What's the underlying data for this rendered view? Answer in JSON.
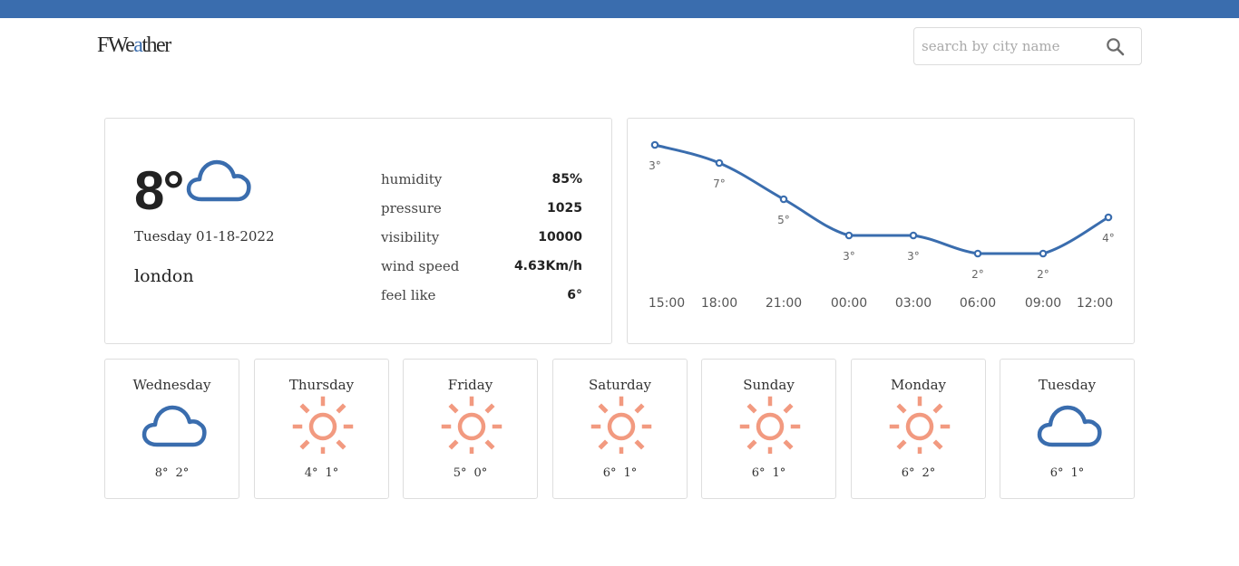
{
  "app": {
    "logo_main": "FWe",
    "logo_accent": "a",
    "logo_end": "ther"
  },
  "search": {
    "placeholder": "search by city name",
    "icon": "search-icon"
  },
  "current": {
    "temperature": "8°",
    "icon": "cloud-icon",
    "date": "Tuesday 01-18-2022",
    "city": "london",
    "stats": [
      {
        "label": "humidity",
        "value": "85%"
      },
      {
        "label": "pressure",
        "value": "1025"
      },
      {
        "label": "visibility",
        "value": "10000"
      },
      {
        "label": "wind speed",
        "value": "4.63Km/h"
      },
      {
        "label": "feel like",
        "value": "6°"
      }
    ]
  },
  "chart_data": {
    "type": "line",
    "categories": [
      "15:00",
      "18:00",
      "21:00",
      "00:00",
      "03:00",
      "06:00",
      "09:00",
      "12:00"
    ],
    "values": [
      8,
      7,
      5,
      3,
      3,
      2,
      2,
      4
    ],
    "point_labels": [
      "3°",
      "7°",
      "5°",
      "3°",
      "3°",
      "2°",
      "2°",
      "4°"
    ],
    "ylim": [
      2,
      8
    ],
    "color": "#3a6dae"
  },
  "forecast": [
    {
      "day": "Wednesday",
      "icon": "cloud-icon",
      "high": "8°",
      "low": "2°"
    },
    {
      "day": "Thursday",
      "icon": "sun-icon",
      "high": "4°",
      "low": "1°"
    },
    {
      "day": "Friday",
      "icon": "sun-icon",
      "high": "5°",
      "low": "0°"
    },
    {
      "day": "Saturday",
      "icon": "sun-icon",
      "high": "6°",
      "low": "1°"
    },
    {
      "day": "Sunday",
      "icon": "sun-icon",
      "high": "6°",
      "low": "1°"
    },
    {
      "day": "Monday",
      "icon": "sun-icon",
      "high": "6°",
      "low": "2°"
    },
    {
      "day": "Tuesday",
      "icon": "cloud-icon",
      "high": "6°",
      "low": "1°"
    }
  ],
  "colors": {
    "accent": "#3a6dae",
    "sun": "#f29a80"
  }
}
